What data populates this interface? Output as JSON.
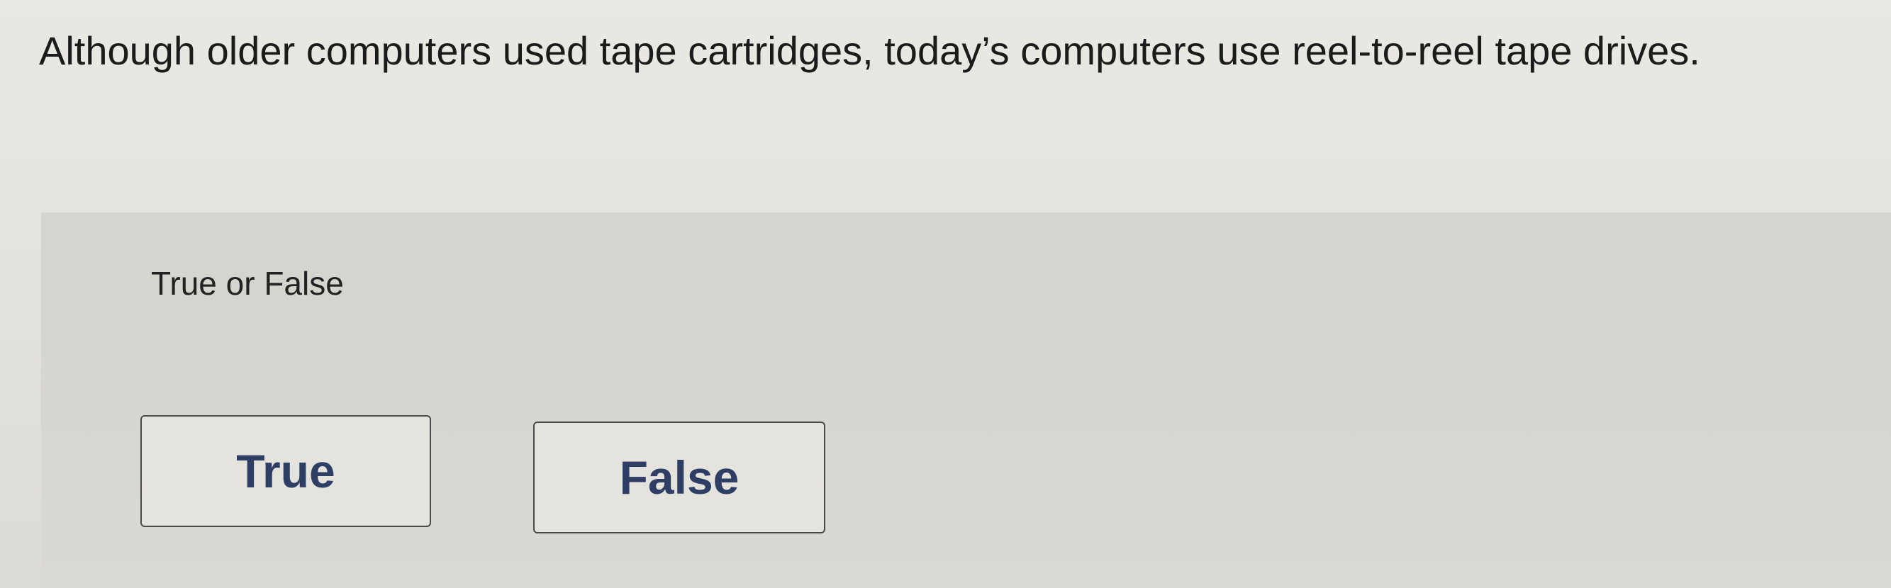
{
  "question": {
    "text": "Although older computers used tape cartridges, today’s computers use reel-to-reel tape drives."
  },
  "answer_area": {
    "prompt": "True or False",
    "choices": [
      {
        "label": "True"
      },
      {
        "label": "False"
      }
    ]
  },
  "colors": {
    "page_background": "#e6e5e0",
    "panel_background": "#d7d6d1",
    "button_text": "#2f3e64",
    "button_border": "#4a4a4a"
  }
}
